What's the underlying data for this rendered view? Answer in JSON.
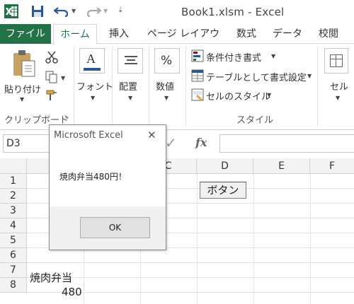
{
  "window": {
    "title": "Book1.xlsm - Excel"
  },
  "quick_access": {
    "icons": [
      "excel-logo-icon",
      "save-icon",
      "undo-icon",
      "redo-icon",
      "customize-icon"
    ]
  },
  "tabs": [
    {
      "label": "ファイル"
    },
    {
      "label": "ホーム"
    },
    {
      "label": "挿入"
    },
    {
      "label": "ページ レイアウト"
    },
    {
      "label": "数式"
    },
    {
      "label": "データ"
    },
    {
      "label": "校閲"
    }
  ],
  "ribbon": {
    "clipboard": {
      "paste_label": "貼り付け",
      "group_label": "クリップボード",
      "launcher": "↘"
    },
    "font": {
      "label": "フォント"
    },
    "alignment": {
      "label": "配置"
    },
    "number": {
      "label": "数値",
      "icon_text": "%"
    },
    "styles": {
      "conditional": "条件付き書式",
      "table": "テーブルとして書式設定",
      "cell_styles": "セルのスタイル",
      "group_label": "スタイル"
    },
    "cells": {
      "label": "セル"
    }
  },
  "formula_bar": {
    "name_box": "D3",
    "fx": "fx",
    "check": "✓"
  },
  "grid": {
    "columns": [
      "C",
      "D",
      "E",
      "F"
    ],
    "rows": [
      "1",
      "2",
      "3",
      "4",
      "5",
      "6",
      "7",
      "8"
    ],
    "cells": {
      "A7": "焼肉弁当",
      "A8": "480"
    },
    "button_label": "ボタン"
  },
  "dialog": {
    "title": "Microsoft Excel",
    "close": "✕",
    "message": "焼肉弁当480円！",
    "ok_label": "OK"
  },
  "colors": {
    "excel_green": "#217346",
    "accent_blue": "#2b579a"
  }
}
